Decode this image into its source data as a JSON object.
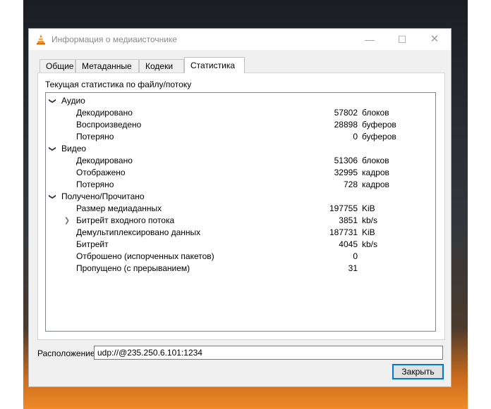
{
  "window": {
    "title": "Информация о медиаисточнике",
    "controls": {
      "minimize": "—",
      "maximize": "☐",
      "close": "✕"
    }
  },
  "tabs": [
    {
      "label": "Общие"
    },
    {
      "label": "Метаданные"
    },
    {
      "label": "Кодеки"
    },
    {
      "label": "Статистика",
      "active": true
    }
  ],
  "panel": {
    "heading": "Текущая статистика по файлу/потоку",
    "tree": {
      "audio": {
        "label": "Аудио",
        "rows": [
          {
            "label": "Декодировано",
            "value": "57802",
            "unit": "блоков"
          },
          {
            "label": "Воспроизведено",
            "value": "28898",
            "unit": "буферов"
          },
          {
            "label": "Потеряно",
            "value": "0",
            "unit": "буферов"
          }
        ]
      },
      "video": {
        "label": "Видео",
        "rows": [
          {
            "label": "Декодировано",
            "value": "51306",
            "unit": "блоков"
          },
          {
            "label": "Отображено",
            "value": "32995",
            "unit": "кадров"
          },
          {
            "label": "Потеряно",
            "value": "728",
            "unit": "кадров"
          }
        ]
      },
      "input": {
        "label": "Получено/Прочитано",
        "rows": [
          {
            "label": "Размер медиаданных",
            "value": "197755",
            "unit": "KiB"
          },
          {
            "label": "Битрейт входного потока",
            "value": "3851",
            "unit": "kb/s"
          },
          {
            "label": "Демультиплексировано данных",
            "value": "187731",
            "unit": "KiB"
          },
          {
            "label": "Битрейт",
            "value": "4045",
            "unit": "kb/s"
          },
          {
            "label": "Отброшено (испорченных пакетов)",
            "value": "0",
            "unit": ""
          },
          {
            "label": "Пропущено (с прерыванием)",
            "value": "31",
            "unit": ""
          }
        ]
      }
    }
  },
  "location": {
    "label": "Расположение:",
    "value": "udp://@235.250.6.101:1234"
  },
  "close_button": "Закрыть"
}
